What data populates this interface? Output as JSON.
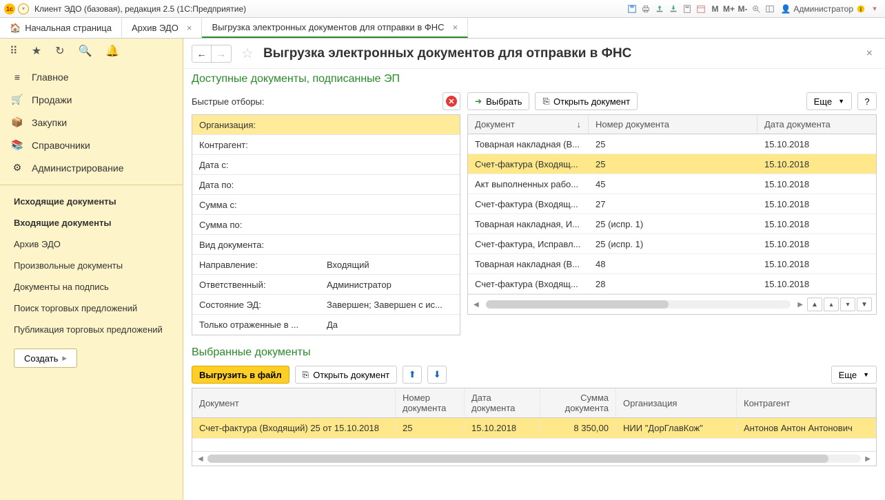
{
  "titlebar": {
    "app_title": "Клиент ЭДО (базовая), редакция 2.5  (1С:Предприятие)",
    "admin_label": "Администратор",
    "m": "M",
    "mp": "M+",
    "mm": "M-"
  },
  "tabs": {
    "home": "Начальная страница",
    "t1": "Архив ЭДО",
    "t2": "Выгрузка электронных документов для отправки в ФНС"
  },
  "sidebar": {
    "nav": {
      "main": "Главное",
      "sales": "Продажи",
      "purchases": "Закупки",
      "refs": "Справочники",
      "admin": "Администрирование"
    },
    "sub": {
      "outgoing": "Исходящие документы",
      "incoming": "Входящие документы",
      "archive": "Архив ЭДО",
      "arbitrary": "Произвольные документы",
      "tosign": "Документы на подпись",
      "search": "Поиск торговых предложений",
      "publish": "Публикация торговых предложений",
      "create": "Создать"
    }
  },
  "page": {
    "title": "Выгрузка электронных документов для отправки в ФНС",
    "sec1": "Доступные документы, подписанные ЭП",
    "sec2": "Выбранные документы",
    "filters_label": "Быстрые отборы:",
    "select_btn": "Выбрать",
    "open_doc_btn": "Открыть документ",
    "more": "Еще",
    "export_btn": "Выгрузить в файл",
    "help": "?"
  },
  "filters": [
    {
      "label": "Организация:",
      "value": "",
      "hl": true
    },
    {
      "label": "Контрагент:",
      "value": ""
    },
    {
      "label": "Дата с:",
      "value": ""
    },
    {
      "label": "Дата по:",
      "value": ""
    },
    {
      "label": "Сумма с:",
      "value": ""
    },
    {
      "label": "Сумма по:",
      "value": ""
    },
    {
      "label": "Вид документа:",
      "value": ""
    },
    {
      "label": "Направление:",
      "value": "Входящий"
    },
    {
      "label": "Ответственный:",
      "value": "Администратор"
    },
    {
      "label": "Состояние ЭД:",
      "value": "Завершен; Завершен с ис..."
    },
    {
      "label": "Только отраженные в ...",
      "value": "Да"
    }
  ],
  "docs_headers": {
    "c1": "Документ",
    "c2": "Номер документа",
    "c3": "Дата документа",
    "sort": "↓"
  },
  "docs": [
    {
      "c1": "Товарная накладная (В...",
      "c2": "25",
      "c3": "15.10.2018"
    },
    {
      "c1": "Счет-фактура (Входящ...",
      "c2": "25",
      "c3": "15.10.2018",
      "sel": true
    },
    {
      "c1": "Акт выполненных рабо...",
      "c2": "45",
      "c3": "15.10.2018"
    },
    {
      "c1": "Счет-фактура (Входящ...",
      "c2": "27",
      "c3": "15.10.2018"
    },
    {
      "c1": "Товарная накладная, И...",
      "c2": "25 (испр. 1)",
      "c3": "15.10.2018"
    },
    {
      "c1": "Счет-фактура, Исправл...",
      "c2": "25 (испр. 1)",
      "c3": "15.10.2018"
    },
    {
      "c1": "Товарная накладная (В...",
      "c2": "48",
      "c3": "15.10.2018"
    },
    {
      "c1": "Счет-фактура (Входящ...",
      "c2": "28",
      "c3": "15.10.2018"
    }
  ],
  "sel_headers": {
    "c1": "Документ",
    "c2": "Номер документа",
    "c3": "Дата документа",
    "c4": "Сумма документа",
    "c5": "Организация",
    "c6": "Контрагент"
  },
  "selected": [
    {
      "c1": "Счет-фактура (Входящий) 25 от 15.10.2018",
      "c2": "25",
      "c3": "15.10.2018",
      "c4": "8 350,00",
      "c5": "НИИ \"ДорГлавКож\"",
      "c6": "Антонов Антон Антонович"
    }
  ]
}
